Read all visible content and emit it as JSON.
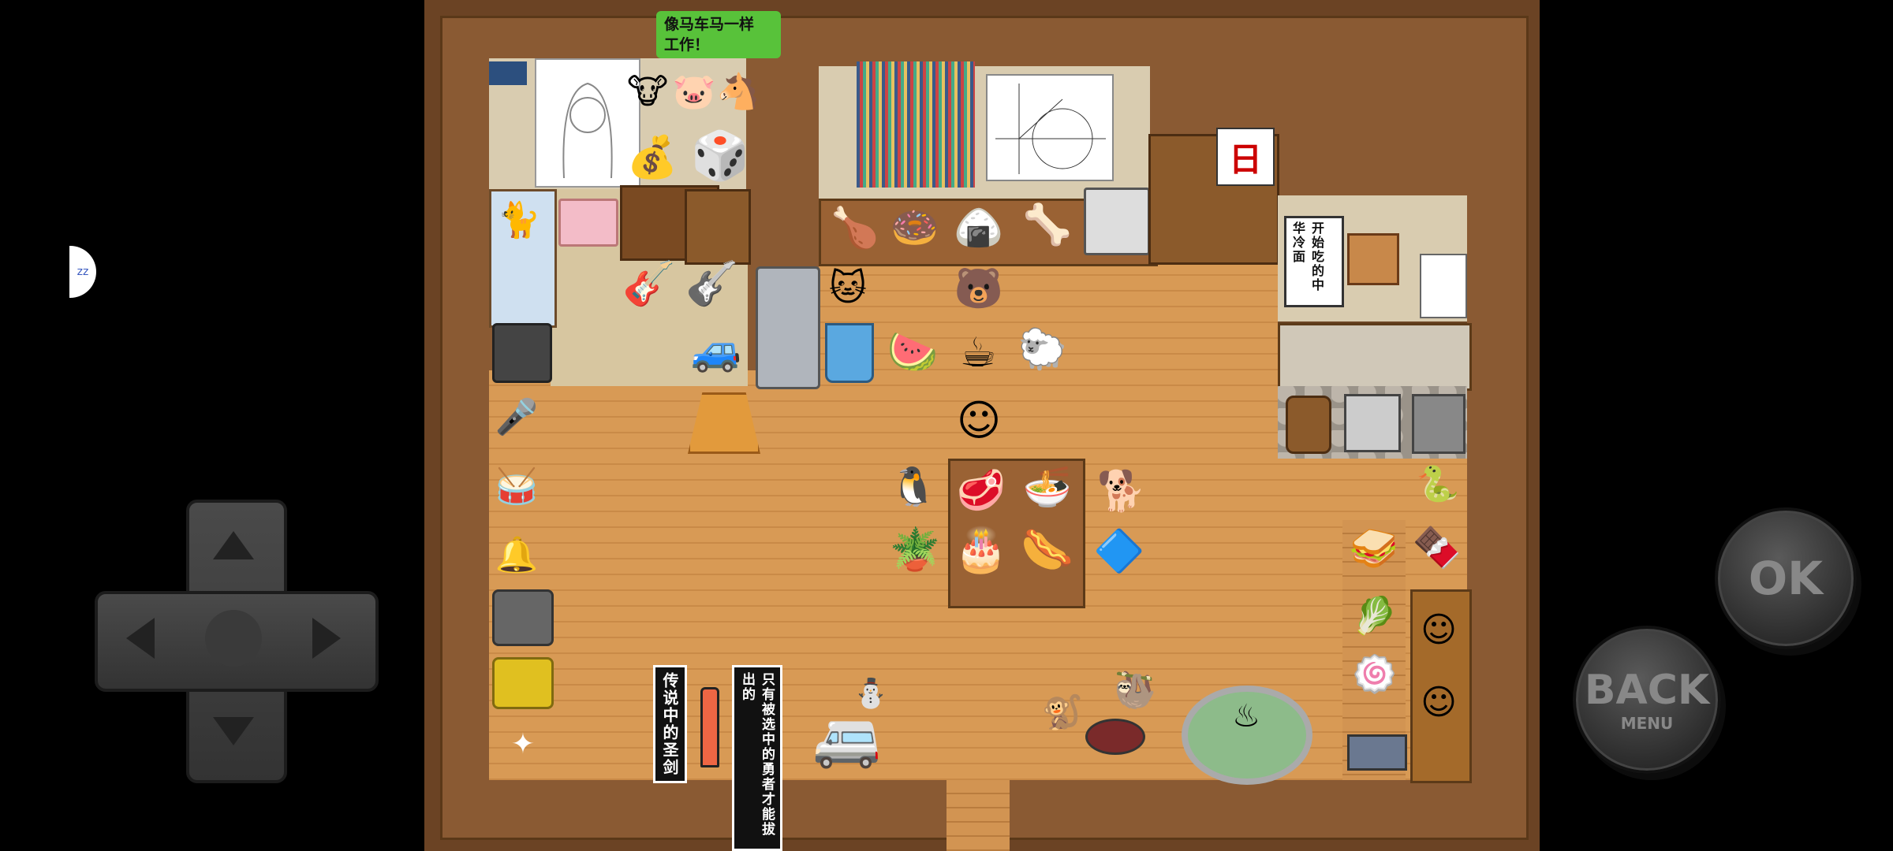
{
  "speech_bubble": "像马车马一样\n工作！",
  "signs": {
    "legend_sword": "传说中的圣剑",
    "only_chosen": "只有被选中的勇者才能拔出的",
    "restaurant_scroll": "开始吃的中华冷面"
  },
  "calendar_char": "日",
  "controls": {
    "ok_label": "OK",
    "back_label": "BACK",
    "menu_label": "MENU",
    "side_indicator": "zz"
  },
  "colors": {
    "speech_bg": "#58c23a",
    "floor": "#d89a55",
    "wall": "#6b4324",
    "button": "#333333"
  },
  "icons": [
    "up-arrow-icon",
    "down-arrow-icon",
    "left-arrow-icon",
    "right-arrow-icon"
  ]
}
